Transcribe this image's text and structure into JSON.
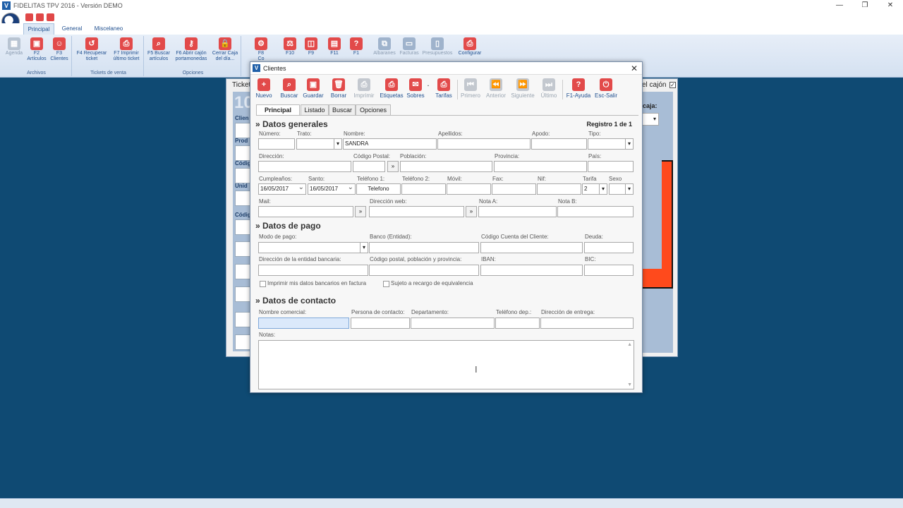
{
  "app": {
    "title": "FIDELITAS TPV 2016 - Versión DEMO",
    "logo_letter": "V",
    "window_controls": [
      "—",
      "❐",
      "✕"
    ]
  },
  "ribbon_tabs": [
    "Principal",
    "General",
    "Miscelaneo"
  ],
  "ribbon": {
    "groups": [
      "Archivos",
      "Tickets de venta",
      "Opciones"
    ],
    "archivos": [
      {
        "l1": "Agenda",
        "l2": "",
        "icon": "calendar-icon",
        "glyph": "▦",
        "disabled": true
      },
      {
        "l1": "F2",
        "l2": "Artículos",
        "icon": "box-icon",
        "glyph": "▣",
        "disabled": false
      },
      {
        "l1": "F3",
        "l2": "Clientes",
        "icon": "users-icon",
        "glyph": "☺",
        "disabled": false
      }
    ],
    "tickets": [
      {
        "l1": "F4 Recuperar",
        "l2": "ticket",
        "icon": "recover-icon",
        "glyph": "↺"
      },
      {
        "l1": "F7 Imprimir",
        "l2": "último ticket",
        "icon": "printer-icon",
        "glyph": "⎙"
      }
    ],
    "opciones": [
      {
        "l1": "F5 Buscar",
        "l2": "artículos",
        "icon": "search-icon",
        "glyph": "⌕"
      },
      {
        "l1": "F6 Abrir cajón",
        "l2": "portamonedas",
        "icon": "key-icon",
        "glyph": "⚷"
      },
      {
        "l1": "Cerrar Caja",
        "l2": "del día...",
        "icon": "lock-icon",
        "glyph": "🔒"
      }
    ],
    "others": [
      {
        "l1": "F8",
        "l2": "Co",
        "icon": "gear-icon",
        "glyph": "⚙",
        "disabled": false
      },
      {
        "l1": "F10",
        "l2": "",
        "icon": "scale-icon",
        "glyph": "⚖",
        "disabled": false
      },
      {
        "l1": "F9",
        "l2": "",
        "icon": "bag-icon",
        "glyph": "◫",
        "disabled": false
      },
      {
        "l1": "F11",
        "l2": "",
        "icon": "book-icon",
        "glyph": "▤",
        "disabled": false
      },
      {
        "l1": "F1",
        "l2": "",
        "icon": "help-icon",
        "glyph": "?",
        "disabled": false
      },
      {
        "l1": "Albaranes",
        "l2": "",
        "icon": "delivery-note-icon",
        "glyph": "⧉",
        "disabled": true
      },
      {
        "l1": "Facturas",
        "l2": "",
        "icon": "invoices-icon",
        "glyph": "▭",
        "disabled": true
      },
      {
        "l1": "Presupuestos",
        "l2": "",
        "icon": "quotes-icon",
        "glyph": "▯",
        "disabled": true
      },
      {
        "l1": "Configurar",
        "l2": "",
        "icon": "printer-config-icon",
        "glyph": "⎙",
        "disabled": false
      }
    ]
  },
  "ticket_window": {
    "title": "Ticket",
    "big_number": "10",
    "side_labels": [
      "Clien",
      "Prod",
      "Códig",
      "Unid",
      "Códig"
    ],
    "cajon_label": "el cajón",
    "caja_label": "caja:",
    "caja_value": "▾",
    "checkbox_mark": "✓"
  },
  "dialog": {
    "title": "Clientes",
    "close": "✕",
    "toolbar": [
      {
        "label": "Nuevo",
        "icon": "plus-icon",
        "glyph": "+",
        "disabled": false
      },
      {
        "label": "Buscar",
        "icon": "search-icon",
        "glyph": "⌕",
        "disabled": false
      },
      {
        "label": "Guardar",
        "icon": "save-icon",
        "glyph": "▣",
        "disabled": false
      },
      {
        "label": "Borrar",
        "icon": "trash-icon",
        "glyph": "🗑",
        "disabled": false
      },
      {
        "label": "Imprimir",
        "icon": "printer-icon",
        "glyph": "⎙",
        "disabled": true
      },
      {
        "label": "Etiquetas",
        "icon": "labels-icon",
        "glyph": "⎙",
        "disabled": false
      },
      {
        "label": "Sobres",
        "icon": "envelope-icon",
        "glyph": "✉",
        "disabled": false
      },
      {
        "label": "Tarifas",
        "icon": "tariffs-icon",
        "glyph": "⎙",
        "disabled": false
      },
      {
        "label": "Primero",
        "icon": "first-icon",
        "glyph": "⏮",
        "disabled": true
      },
      {
        "label": "Anterior",
        "icon": "previous-icon",
        "glyph": "⏪",
        "disabled": true
      },
      {
        "label": "Siguiente",
        "icon": "next-icon",
        "glyph": "⏩",
        "disabled": true
      },
      {
        "label": "Último",
        "icon": "last-icon",
        "glyph": "⏭",
        "disabled": true
      },
      {
        "label": "F1-Ayuda",
        "icon": "help-icon",
        "glyph": "?",
        "disabled": false
      },
      {
        "label": "Esc-Salir",
        "icon": "power-icon",
        "glyph": "⏻",
        "disabled": false
      }
    ],
    "sobres_dot": ".",
    "tabs": [
      "Principal",
      "Listado",
      "Buscar",
      "Opciones"
    ],
    "registro": "Registro 1 de 1",
    "sections": {
      "generales": "» Datos generales",
      "pago": "» Datos de pago",
      "contacto": "» Datos de contacto"
    },
    "labels": {
      "numero": "Número:",
      "trato": "Trato:",
      "nombre": "Nombre:",
      "apellidos": "Apellidos:",
      "apodo": "Apodo:",
      "tipo": "Tipo:",
      "direccion": "Dirección:",
      "codigo_postal": "Código Postal:",
      "poblacion": "Población:",
      "provincia": "Provincia:",
      "pais": "País:",
      "cumpleanos": "Cumpleaños:",
      "santo": "Santo:",
      "telefono1": "Teléfono 1:",
      "telefono2": "Teléfono 2:",
      "movil": "Móvil:",
      "fax": "Fax:",
      "nif": "Nif:",
      "tarifa": "Tarifa",
      "sexo": "Sexo",
      "mail": "Mail:",
      "web": "Dirección web:",
      "nota_a": "Nota A:",
      "nota_b": "Nota B:",
      "modo_pago": "Modo de pago:",
      "banco": "Banco (Entidad):",
      "cuenta": "Código Cuenta del Cliente:",
      "deuda": "Deuda:",
      "dir_banco": "Dirección de la entidad bancaria:",
      "cp_banco": "Código postal, población y provincia:",
      "iban": "IBAN:",
      "bic": "BIC:",
      "chk_imprimir": "Imprimir mis datos bancarios en factura",
      "chk_recargo": "Sujeto a recargo de equivalencia",
      "nombre_comercial": "Nombre comercial:",
      "persona": "Persona de contacto:",
      "departamento": "Departamento:",
      "telefono_dep": "Teléfono dep.:",
      "dir_entrega": "Dirección de entrega:",
      "notas": "Notas:"
    },
    "values": {
      "nombre": "SANDRA",
      "cumpleanos": "16/05/2017",
      "santo": "16/05/2017",
      "telefono1": "Telefono",
      "tarifa": "2",
      "arrow": "»",
      "scroll_up": "▲",
      "scroll_down": "▼"
    }
  }
}
